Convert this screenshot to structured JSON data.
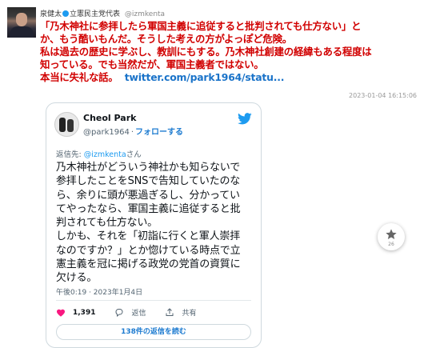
{
  "post": {
    "author": "泉健太",
    "author_title": "立憲民主党代表",
    "handle": "@izmkenta",
    "text_lines": [
      "「乃木神社に参拝したら軍国主義に追従すると批判されても仕方ない」と",
      "か、もう酷いもんだ。そうした考えの方がよっぽど危険。",
      "私は過去の歴史に学ぶし、教訓にもする。乃木神社創建の経緯もある程度は",
      "知っている。でも当然だが、軍国主義者ではない。",
      "本当に失礼な話。"
    ],
    "link": "twitter.com/park1964/statu...",
    "timestamp": "2023-01-04 16:15:06"
  },
  "embedded": {
    "name": "Cheol Park",
    "handle": "@park1964",
    "separator": "·",
    "follow_label": "フォローする",
    "reply_prefix": "返信先: ",
    "reply_handle": "@izmkenta",
    "reply_suffix": "さん",
    "body": "乃木神社がどういう神社かも知らないで\n参拝したことをSNSで告知していたのな\nら、余りに頭が悪過ぎるし、分かってい\nてやったなら、軍国主義に追従すると批\n判されても仕方ない。\nしかも、それを「初詣に行くと軍人崇拝\nなのですか？」とか惚けている時点で立\n憲主義を冠に掲げる政党の党首の資質に\n欠ける。",
    "time": "午後0:19 · 2023年1月4日",
    "likes": "1,391",
    "reply_label": "返信",
    "share_label": "共有",
    "read_replies_label": "138件の返信を読む"
  },
  "fav": {
    "count": "26"
  },
  "colors": {
    "post_text": "#d10000",
    "link": "#1a73c9",
    "twitter_blue": "#1d9bf0",
    "like_red": "#f91880"
  },
  "icons": [
    "verified-badge-icon",
    "twitter-bird-icon",
    "heart-icon",
    "reply-icon",
    "share-icon",
    "star-icon"
  ]
}
